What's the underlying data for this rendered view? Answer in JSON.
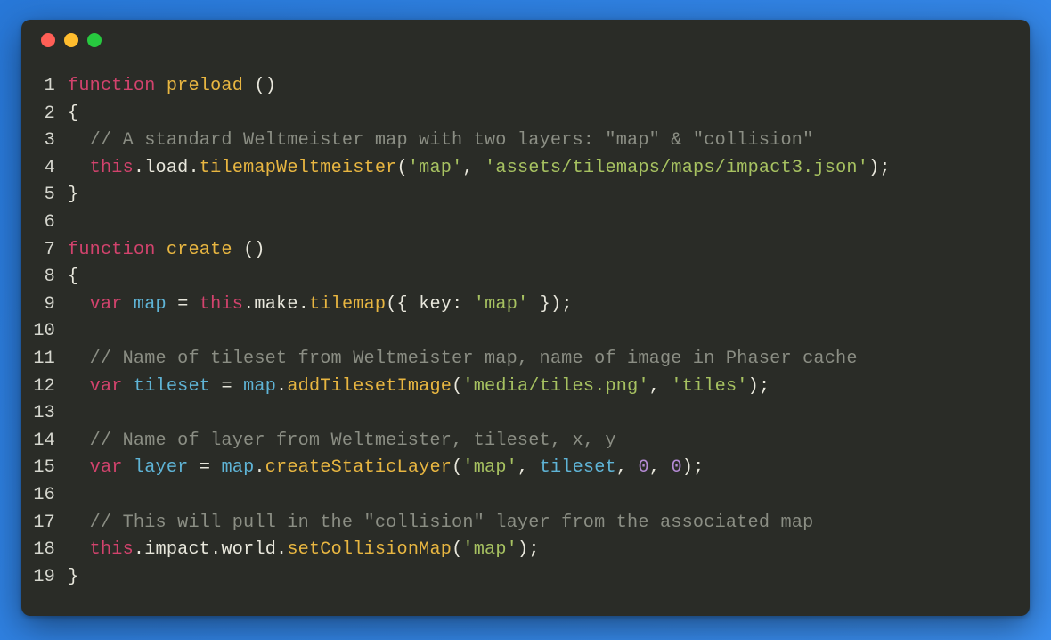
{
  "window": {
    "dots": [
      "red",
      "yellow",
      "green"
    ]
  },
  "colors": {
    "keyword": "#d2436d",
    "funcname": "#e8b641",
    "string": "#a7c261",
    "comment": "#8b8e84",
    "number": "#b48ad4",
    "ident": "#5fb4d6",
    "plain": "#e8e7dc",
    "bg": "#2a2c27"
  },
  "code": {
    "lines": [
      {
        "n": 1,
        "t": [
          [
            "keyword",
            "function"
          ],
          [
            "plain",
            " "
          ],
          [
            "funcname",
            "preload"
          ],
          [
            "plain",
            " "
          ],
          [
            "paren",
            "()"
          ]
        ]
      },
      {
        "n": 2,
        "t": [
          [
            "plain",
            "{"
          ]
        ]
      },
      {
        "n": 3,
        "t": [
          [
            "plain",
            "  "
          ],
          [
            "comment",
            "// A standard Weltmeister map with two layers: \"map\" & \"collision\""
          ]
        ]
      },
      {
        "n": 4,
        "t": [
          [
            "plain",
            "  "
          ],
          [
            "this",
            "this"
          ],
          [
            "plain",
            "."
          ],
          [
            "prop",
            "load"
          ],
          [
            "plain",
            "."
          ],
          [
            "method",
            "tilemapWeltmeister"
          ],
          [
            "paren",
            "("
          ],
          [
            "string",
            "'map'"
          ],
          [
            "plain",
            ", "
          ],
          [
            "string",
            "'assets/tilemaps/maps/impact3.json'"
          ],
          [
            "paren",
            ")"
          ],
          [
            "plain",
            ";"
          ]
        ]
      },
      {
        "n": 5,
        "t": [
          [
            "plain",
            "}"
          ]
        ]
      },
      {
        "n": 6,
        "t": [
          [
            "plain",
            ""
          ]
        ]
      },
      {
        "n": 7,
        "t": [
          [
            "keyword",
            "function"
          ],
          [
            "plain",
            " "
          ],
          [
            "funcname",
            "create"
          ],
          [
            "plain",
            " "
          ],
          [
            "paren",
            "()"
          ]
        ]
      },
      {
        "n": 8,
        "t": [
          [
            "plain",
            "{"
          ]
        ]
      },
      {
        "n": 9,
        "t": [
          [
            "plain",
            "  "
          ],
          [
            "keyword",
            "var"
          ],
          [
            "plain",
            " "
          ],
          [
            "ident",
            "map"
          ],
          [
            "plain",
            " = "
          ],
          [
            "this",
            "this"
          ],
          [
            "plain",
            "."
          ],
          [
            "prop",
            "make"
          ],
          [
            "plain",
            "."
          ],
          [
            "method",
            "tilemap"
          ],
          [
            "paren",
            "("
          ],
          [
            "plain",
            "{ "
          ],
          [
            "prop",
            "key"
          ],
          [
            "plain",
            ": "
          ],
          [
            "string",
            "'map'"
          ],
          [
            "plain",
            " }"
          ],
          [
            "paren",
            ")"
          ],
          [
            "plain",
            ";"
          ]
        ]
      },
      {
        "n": 10,
        "t": [
          [
            "plain",
            ""
          ]
        ]
      },
      {
        "n": 11,
        "t": [
          [
            "plain",
            "  "
          ],
          [
            "comment",
            "// Name of tileset from Weltmeister map, name of image in Phaser cache"
          ]
        ]
      },
      {
        "n": 12,
        "t": [
          [
            "plain",
            "  "
          ],
          [
            "keyword",
            "var"
          ],
          [
            "plain",
            " "
          ],
          [
            "ident",
            "tileset"
          ],
          [
            "plain",
            " = "
          ],
          [
            "ident",
            "map"
          ],
          [
            "plain",
            "."
          ],
          [
            "method",
            "addTilesetImage"
          ],
          [
            "paren",
            "("
          ],
          [
            "string",
            "'media/tiles.png'"
          ],
          [
            "plain",
            ", "
          ],
          [
            "string",
            "'tiles'"
          ],
          [
            "paren",
            ")"
          ],
          [
            "plain",
            ";"
          ]
        ]
      },
      {
        "n": 13,
        "t": [
          [
            "plain",
            ""
          ]
        ]
      },
      {
        "n": 14,
        "t": [
          [
            "plain",
            "  "
          ],
          [
            "comment",
            "// Name of layer from Weltmeister, tileset, x, y"
          ]
        ]
      },
      {
        "n": 15,
        "t": [
          [
            "plain",
            "  "
          ],
          [
            "keyword",
            "var"
          ],
          [
            "plain",
            " "
          ],
          [
            "ident",
            "layer"
          ],
          [
            "plain",
            " = "
          ],
          [
            "ident",
            "map"
          ],
          [
            "plain",
            "."
          ],
          [
            "method",
            "createStaticLayer"
          ],
          [
            "paren",
            "("
          ],
          [
            "string",
            "'map'"
          ],
          [
            "plain",
            ", "
          ],
          [
            "ident",
            "tileset"
          ],
          [
            "plain",
            ", "
          ],
          [
            "number",
            "0"
          ],
          [
            "plain",
            ", "
          ],
          [
            "number",
            "0"
          ],
          [
            "paren",
            ")"
          ],
          [
            "plain",
            ";"
          ]
        ]
      },
      {
        "n": 16,
        "t": [
          [
            "plain",
            ""
          ]
        ]
      },
      {
        "n": 17,
        "t": [
          [
            "plain",
            "  "
          ],
          [
            "comment",
            "// This will pull in the \"collision\" layer from the associated map"
          ]
        ]
      },
      {
        "n": 18,
        "t": [
          [
            "plain",
            "  "
          ],
          [
            "this",
            "this"
          ],
          [
            "plain",
            "."
          ],
          [
            "prop",
            "impact"
          ],
          [
            "plain",
            "."
          ],
          [
            "prop",
            "world"
          ],
          [
            "plain",
            "."
          ],
          [
            "method",
            "setCollisionMap"
          ],
          [
            "paren",
            "("
          ],
          [
            "string",
            "'map'"
          ],
          [
            "paren",
            ")"
          ],
          [
            "plain",
            ";"
          ]
        ]
      },
      {
        "n": 19,
        "t": [
          [
            "plain",
            "}"
          ]
        ]
      }
    ]
  }
}
